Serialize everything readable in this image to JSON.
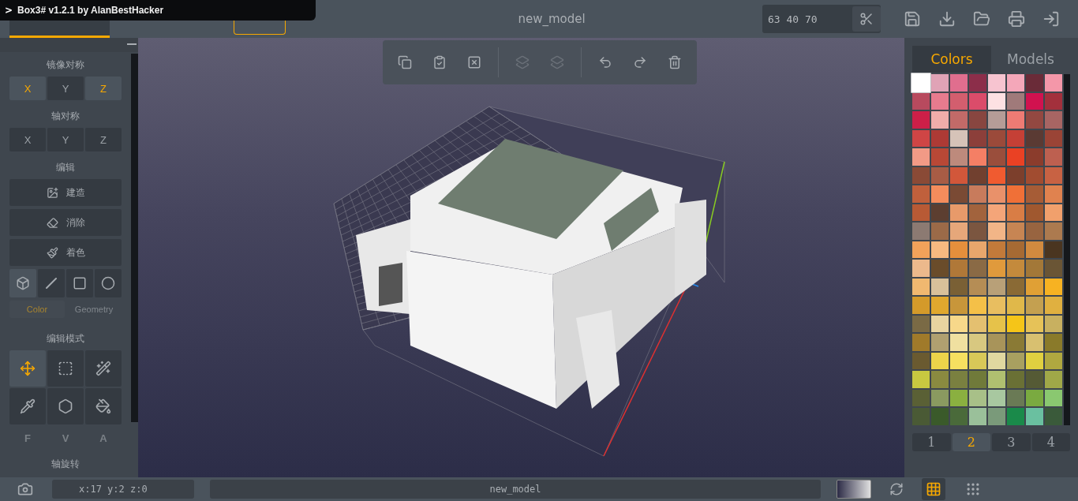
{
  "overlay_title": {
    "icon": ">",
    "text": "Box3# v1.2.1 by AlanBestHacker"
  },
  "top_tabs": [
    {
      "selected": true,
      "kind": "tab"
    },
    {
      "selected": false,
      "kind": "outline"
    }
  ],
  "document_title": "new_model",
  "dimensions": {
    "value": "63 40 70"
  },
  "left_panel": {
    "mirror": {
      "title": "镜像对称",
      "axes": [
        {
          "label": "X",
          "selected": true
        },
        {
          "label": "Y",
          "selected": false
        },
        {
          "label": "Z",
          "selected": true
        }
      ]
    },
    "axis_symmetry": {
      "title": "轴对称",
      "axes": [
        {
          "label": "X",
          "selected": false
        },
        {
          "label": "Y",
          "selected": false
        },
        {
          "label": "Z",
          "selected": false
        }
      ]
    },
    "edit": {
      "title": "编辑",
      "actions": [
        {
          "label": "建造",
          "kind": "build"
        },
        {
          "label": "消除",
          "kind": "erase"
        },
        {
          "label": "着色",
          "kind": "paint"
        }
      ]
    },
    "shapes": [
      {
        "kind": "cube",
        "selected": true
      },
      {
        "kind": "line",
        "selected": false
      },
      {
        "kind": "square",
        "selected": false
      },
      {
        "kind": "circle",
        "selected": false
      }
    ],
    "mode_tabs": [
      {
        "label": "Color",
        "selected": true
      },
      {
        "label": "Geometry",
        "selected": false
      }
    ],
    "edit_mode": {
      "title": "编辑模式",
      "tools": [
        {
          "kind": "move",
          "selected": true
        },
        {
          "kind": "select",
          "selected": false
        },
        {
          "kind": "wand",
          "selected": false
        },
        {
          "kind": "picker",
          "selected": false
        },
        {
          "kind": "delete",
          "selected": false
        },
        {
          "kind": "fill",
          "selected": false
        }
      ]
    },
    "face_modes": [
      {
        "label": "F",
        "disabled": true
      },
      {
        "label": "V",
        "disabled": true
      },
      {
        "label": "A",
        "disabled": true
      }
    ],
    "rotation": {
      "title": "轴旋转"
    }
  },
  "viewport_toolbar": [
    {
      "kind": "copy",
      "disabled": false
    },
    {
      "kind": "paste",
      "disabled": false
    },
    {
      "kind": "clear",
      "disabled": false
    },
    {
      "kind": "front",
      "disabled": true
    },
    {
      "kind": "back",
      "disabled": true
    },
    {
      "kind": "undo",
      "disabled": false
    },
    {
      "kind": "redo",
      "disabled": false
    },
    {
      "kind": "trash",
      "disabled": false
    }
  ],
  "right_panel": {
    "tabs": [
      {
        "label": "Colors",
        "selected": true
      },
      {
        "label": "Models",
        "selected": false
      }
    ],
    "swatches": [
      {
        "color": "#ffffff",
        "selected": true
      },
      {
        "color": "#e0a3b6",
        "selected": false
      },
      {
        "color": "#e06e8e",
        "selected": false
      },
      {
        "color": "#8c2e4a",
        "selected": false
      },
      {
        "color": "#f7c4d0",
        "selected": false
      },
      {
        "color": "#f4a7b9",
        "selected": false
      },
      {
        "color": "#6a2b38",
        "selected": false
      },
      {
        "color": "#f497a9",
        "selected": false
      },
      {
        "color": "#b84a5e",
        "selected": false
      },
      {
        "color": "#e77b8e",
        "selected": false
      },
      {
        "color": "#d35e6e",
        "selected": false
      },
      {
        "color": "#db4c6a",
        "selected": false
      },
      {
        "color": "#fde1e3",
        "selected": false
      },
      {
        "color": "#a07a7a",
        "selected": false
      },
      {
        "color": "#d1124f",
        "selected": false
      },
      {
        "color": "#a3303c",
        "selected": false
      },
      {
        "color": "#cd1f48",
        "selected": false
      },
      {
        "color": "#f0adaa",
        "selected": false
      },
      {
        "color": "#c26a68",
        "selected": false
      },
      {
        "color": "#884640",
        "selected": false
      },
      {
        "color": "#b59c97",
        "selected": false
      },
      {
        "color": "#ee7b74",
        "selected": false
      },
      {
        "color": "#934841",
        "selected": false
      },
      {
        "color": "#a86563",
        "selected": false
      },
      {
        "color": "#cf4545",
        "selected": false
      },
      {
        "color": "#ad3a35",
        "selected": false
      },
      {
        "color": "#d6c3b8",
        "selected": false
      },
      {
        "color": "#8c3f3a",
        "selected": false
      },
      {
        "color": "#9b4a3a",
        "selected": false
      },
      {
        "color": "#c54036",
        "selected": false
      },
      {
        "color": "#5a3a33",
        "selected": false
      },
      {
        "color": "#9a4436",
        "selected": false
      },
      {
        "color": "#f29a86",
        "selected": false
      },
      {
        "color": "#b84836",
        "selected": false
      },
      {
        "color": "#bd8a7c",
        "selected": false
      },
      {
        "color": "#f47f65",
        "selected": false
      },
      {
        "color": "#9a4e3c",
        "selected": false
      },
      {
        "color": "#ea4124",
        "selected": false
      },
      {
        "color": "#8b3c2c",
        "selected": false
      },
      {
        "color": "#bd6050",
        "selected": false
      },
      {
        "color": "#8a4a36",
        "selected": false
      },
      {
        "color": "#a85c45",
        "selected": false
      },
      {
        "color": "#d2573a",
        "selected": false
      },
      {
        "color": "#71402f",
        "selected": false
      },
      {
        "color": "#f05b30",
        "selected": false
      },
      {
        "color": "#7c3f2c",
        "selected": false
      },
      {
        "color": "#a14c30",
        "selected": false
      },
      {
        "color": "#c86243",
        "selected": false
      },
      {
        "color": "#c0603c",
        "selected": false
      },
      {
        "color": "#f48c5c",
        "selected": false
      },
      {
        "color": "#7a4a34",
        "selected": false
      },
      {
        "color": "#c87b5c",
        "selected": false
      },
      {
        "color": "#e9916a",
        "selected": false
      },
      {
        "color": "#f07037",
        "selected": false
      },
      {
        "color": "#a65c36",
        "selected": false
      },
      {
        "color": "#e0824f",
        "selected": false
      },
      {
        "color": "#b85a35",
        "selected": false
      },
      {
        "color": "#5c3e30",
        "selected": false
      },
      {
        "color": "#e89a6a",
        "selected": false
      },
      {
        "color": "#a2633d",
        "selected": false
      },
      {
        "color": "#f4a579",
        "selected": false
      },
      {
        "color": "#d97d45",
        "selected": false
      },
      {
        "color": "#a0582f",
        "selected": false
      },
      {
        "color": "#f1a06c",
        "selected": false
      },
      {
        "color": "#8c7a72",
        "selected": false
      },
      {
        "color": "#9b6a48",
        "selected": false
      },
      {
        "color": "#e6a77a",
        "selected": false
      },
      {
        "color": "#7b5640",
        "selected": false
      },
      {
        "color": "#f2b587",
        "selected": false
      },
      {
        "color": "#c78553",
        "selected": false
      },
      {
        "color": "#986440",
        "selected": false
      },
      {
        "color": "#ac7a4f",
        "selected": false
      },
      {
        "color": "#f2a25a",
        "selected": false
      },
      {
        "color": "#f7b980",
        "selected": false
      },
      {
        "color": "#e58f3c",
        "selected": false
      },
      {
        "color": "#e8a66c",
        "selected": false
      },
      {
        "color": "#c27a3a",
        "selected": false
      },
      {
        "color": "#a66a33",
        "selected": false
      },
      {
        "color": "#d18a3f",
        "selected": false
      },
      {
        "color": "#4a3520",
        "selected": false
      },
      {
        "color": "#ecb98c",
        "selected": false
      },
      {
        "color": "#6a4c2a",
        "selected": false
      },
      {
        "color": "#b07838",
        "selected": false
      },
      {
        "color": "#8a6a45",
        "selected": false
      },
      {
        "color": "#e09a3c",
        "selected": false
      },
      {
        "color": "#c48a3c",
        "selected": false
      },
      {
        "color": "#a37838",
        "selected": false
      },
      {
        "color": "#6a5535",
        "selected": false
      },
      {
        "color": "#f0b870",
        "selected": false
      },
      {
        "color": "#d8c09a",
        "selected": false
      },
      {
        "color": "#7a6035",
        "selected": false
      },
      {
        "color": "#b58d55",
        "selected": false
      },
      {
        "color": "#b8a078",
        "selected": false
      },
      {
        "color": "#8a6a35",
        "selected": false
      },
      {
        "color": "#e0a035",
        "selected": false
      },
      {
        "color": "#f7b222",
        "selected": false
      },
      {
        "color": "#d49a2a",
        "selected": false
      },
      {
        "color": "#e0a82e",
        "selected": false
      },
      {
        "color": "#c8963a",
        "selected": false
      },
      {
        "color": "#f4c048",
        "selected": false
      },
      {
        "color": "#e8be60",
        "selected": false
      },
      {
        "color": "#e0b84a",
        "selected": false
      },
      {
        "color": "#c4a050",
        "selected": false
      },
      {
        "color": "#e0b040",
        "selected": false
      },
      {
        "color": "#7a6a45",
        "selected": false
      },
      {
        "color": "#e8d4a0",
        "selected": false
      },
      {
        "color": "#f7d88a",
        "selected": false
      },
      {
        "color": "#e4c070",
        "selected": false
      },
      {
        "color": "#e6c24a",
        "selected": false
      },
      {
        "color": "#f5c518",
        "selected": false
      },
      {
        "color": "#e6c258",
        "selected": false
      },
      {
        "color": "#c8b060",
        "selected": false
      },
      {
        "color": "#a07a2a",
        "selected": false
      },
      {
        "color": "#b0a070",
        "selected": false
      },
      {
        "color": "#f0e0a0",
        "selected": false
      },
      {
        "color": "#d8c880",
        "selected": false
      },
      {
        "color": "#a8945a",
        "selected": false
      },
      {
        "color": "#8a7a35",
        "selected": false
      },
      {
        "color": "#d8c070",
        "selected": false
      },
      {
        "color": "#8a7a2a",
        "selected": false
      },
      {
        "color": "#6a5a30",
        "selected": false
      },
      {
        "color": "#ecd44a",
        "selected": false
      },
      {
        "color": "#f6e060",
        "selected": false
      },
      {
        "color": "#d8c858",
        "selected": false
      },
      {
        "color": "#e0d8a0",
        "selected": false
      },
      {
        "color": "#a8a060",
        "selected": false
      },
      {
        "color": "#e0d040",
        "selected": false
      },
      {
        "color": "#b0a840",
        "selected": false
      },
      {
        "color": "#c8c840",
        "selected": false
      },
      {
        "color": "#8a8a40",
        "selected": false
      },
      {
        "color": "#7a8040",
        "selected": false
      },
      {
        "color": "#707a3a",
        "selected": false
      },
      {
        "color": "#b0c070",
        "selected": false
      },
      {
        "color": "#6a7035",
        "selected": false
      },
      {
        "color": "#555a35",
        "selected": false
      },
      {
        "color": "#a0a848",
        "selected": false
      },
      {
        "color": "#5a6035",
        "selected": false
      },
      {
        "color": "#8a9a60",
        "selected": false
      },
      {
        "color": "#8ab040",
        "selected": false
      },
      {
        "color": "#a8c088",
        "selected": false
      },
      {
        "color": "#a8c8a0",
        "selected": false
      },
      {
        "color": "#6a7a55",
        "selected": false
      },
      {
        "color": "#7aaa40",
        "selected": false
      },
      {
        "color": "#8ac870",
        "selected": false
      },
      {
        "color": "#4a5a35",
        "selected": false
      },
      {
        "color": "#3a5a2a",
        "selected": false
      },
      {
        "color": "#4a6a3a",
        "selected": false
      },
      {
        "color": "#9ac09a",
        "selected": false
      },
      {
        "color": "#7a9a7a",
        "selected": false
      },
      {
        "color": "#1a8a4a",
        "selected": false
      },
      {
        "color": "#6ac0a0",
        "selected": false
      },
      {
        "color": "#3a5a3a",
        "selected": false
      }
    ],
    "pages": [
      {
        "label": "1",
        "selected": false
      },
      {
        "label": "2",
        "selected": true
      },
      {
        "label": "3",
        "selected": false
      },
      {
        "label": "4",
        "selected": false
      }
    ]
  },
  "status_bar": {
    "coordinates": "x:17 y:2 z:0",
    "model_name": "new_model",
    "grid_modes": [
      {
        "kind": "lines",
        "selected": true
      },
      {
        "kind": "dots",
        "selected": false
      }
    ]
  }
}
